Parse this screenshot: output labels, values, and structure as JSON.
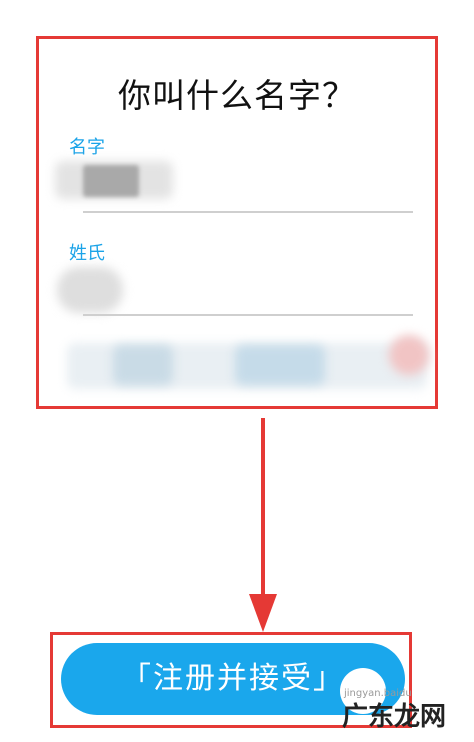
{
  "form": {
    "title": "你叫什么名字？",
    "first_name": {
      "label": "名字",
      "value": "",
      "placeholder": ""
    },
    "last_name": {
      "label": "姓氏",
      "value": "",
      "placeholder": ""
    }
  },
  "actions": {
    "register_label": "「注册并接受」"
  },
  "watermark": {
    "text": "广东龙网",
    "sub": "jingyan.baidu"
  },
  "colors": {
    "highlight": "#e53935",
    "accent": "#1aa7ec",
    "label": "#1aa3e8"
  },
  "icons": {
    "arrow": "arrow-down-icon"
  }
}
